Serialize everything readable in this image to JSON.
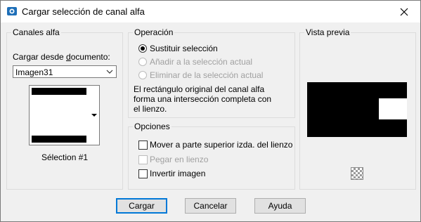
{
  "window": {
    "title": "Cargar selección de canal alfa"
  },
  "channels": {
    "group_label": "Canales alfa",
    "load_from_label": "Cargar desde documento:",
    "document_value": "Imagen31",
    "selection_caption": "Sélection #1"
  },
  "operation": {
    "group_label": "Operación",
    "options": [
      {
        "label": "Sustituir selección",
        "selected": true,
        "enabled": true
      },
      {
        "label": "Añadir a la selección actual",
        "selected": false,
        "enabled": false
      },
      {
        "label": "Eliminar de la selección actual",
        "selected": false,
        "enabled": false
      }
    ],
    "note_line1": "El rectángulo original del canal alfa",
    "note_line2": "forma una intersección completa con",
    "note_line3": "el lienzo."
  },
  "options": {
    "group_label": "Opciones",
    "items": [
      {
        "label": "Mover a parte superior izda. del lienzo",
        "checked": false,
        "enabled": true
      },
      {
        "label": "Pegar en lienzo",
        "checked": false,
        "enabled": false
      },
      {
        "label": "Invertir imagen",
        "checked": false,
        "enabled": true
      }
    ]
  },
  "preview": {
    "group_label": "Vista previa"
  },
  "buttons": {
    "ok": "Cargar",
    "cancel": "Cancelar",
    "help": "Ayuda"
  },
  "icons": {
    "app": "app-icon",
    "close": "close-icon",
    "dropdown": "chevron-down-icon",
    "checker": "checkerboard-icon"
  },
  "colors": {
    "accent": "#0078d7",
    "frame": "#7a7a7a",
    "disabled_text": "#a0a0a0"
  }
}
